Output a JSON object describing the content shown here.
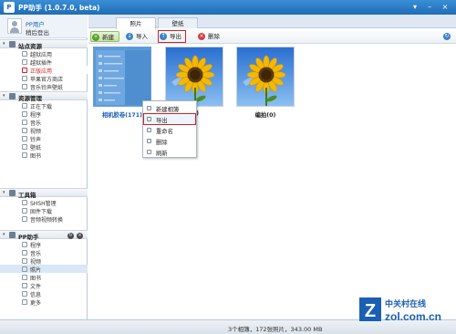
{
  "window": {
    "title": "PP助手 (1.0.7.0, beta)",
    "logo_text": "P",
    "min": "▾",
    "max": "–",
    "close": "×"
  },
  "user": {
    "name": "PP用户",
    "logout": "稍后登出"
  },
  "sidebar": {
    "sections": [
      {
        "label": "站点资源",
        "items": [
          "越狱应用",
          "越狱插件",
          "正版应用",
          "苹果官方商店",
          "音乐铃声壁纸"
        ]
      },
      {
        "label": "资源管理",
        "items": [
          "正在下载",
          "程序",
          "音乐",
          "视频",
          "铃声",
          "壁纸",
          "图书"
        ]
      },
      {
        "label": "工具箱",
        "items": [
          "SHSH管理",
          "固件下载",
          "音频视频转换"
        ]
      },
      {
        "label": "PP助手",
        "items": [
          "程序",
          "音乐",
          "视频",
          "照片",
          "图书",
          "文件",
          "信息",
          "更多"
        ]
      }
    ],
    "active_item": "正版应用",
    "selected_item": "照片"
  },
  "tabs": [
    "照片",
    "壁纸"
  ],
  "active_tab": "照片",
  "toolbar": {
    "new": "新建",
    "import": "导入",
    "export": "导出",
    "delete": "删除"
  },
  "albums": [
    {
      "name": "相机胶卷",
      "count": "(171)"
    },
    {
      "name": "",
      "count": "(1)"
    },
    {
      "name": "编拍",
      "count": "(0)"
    }
  ],
  "context_menu": [
    "新建相簿",
    "导出",
    "重命名",
    "删除",
    "刷新"
  ],
  "status": "3个相簿，172张照片，343.00 MB",
  "watermark": {
    "brand": "中关村在线",
    "url": "zol.com.cn"
  },
  "colors": {
    "accent": "#1f6db6",
    "highlight": "#d42020",
    "selected": "#d9e7f6"
  }
}
